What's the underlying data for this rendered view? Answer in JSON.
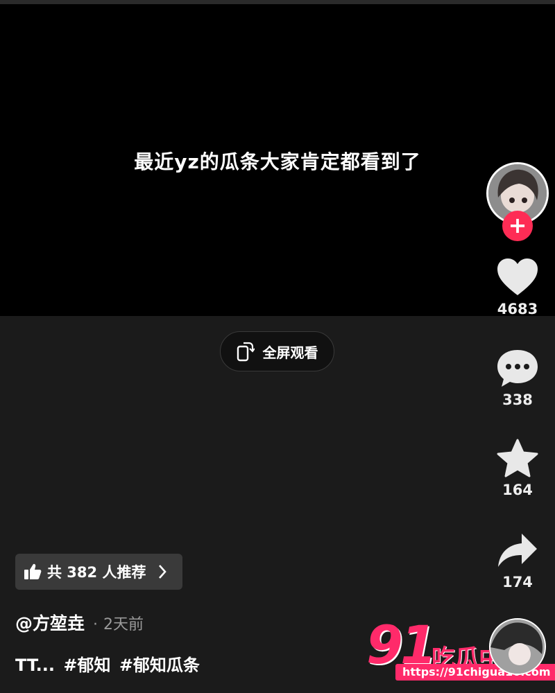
{
  "video": {
    "caption": "最近yz的瓜条大家肯定都看到了",
    "fullscreen_label": "全屏观看"
  },
  "rail": {
    "follow_symbol": "+",
    "likes": "4683",
    "comments": "338",
    "favorites": "164",
    "shares": "174"
  },
  "info": {
    "recommend_label": "共 382 人推荐",
    "author": "@方堃垚",
    "dot": "·",
    "time": "2天前",
    "description": "TT... #郁知 #郁知瓜条"
  },
  "watermark": {
    "number": "91",
    "text": "吃瓜中心",
    "url": "https://91chigua16.com"
  },
  "colors": {
    "accent": "#fe2c55",
    "watermark": "#ff2a6a",
    "background": "#1b1b1b"
  }
}
